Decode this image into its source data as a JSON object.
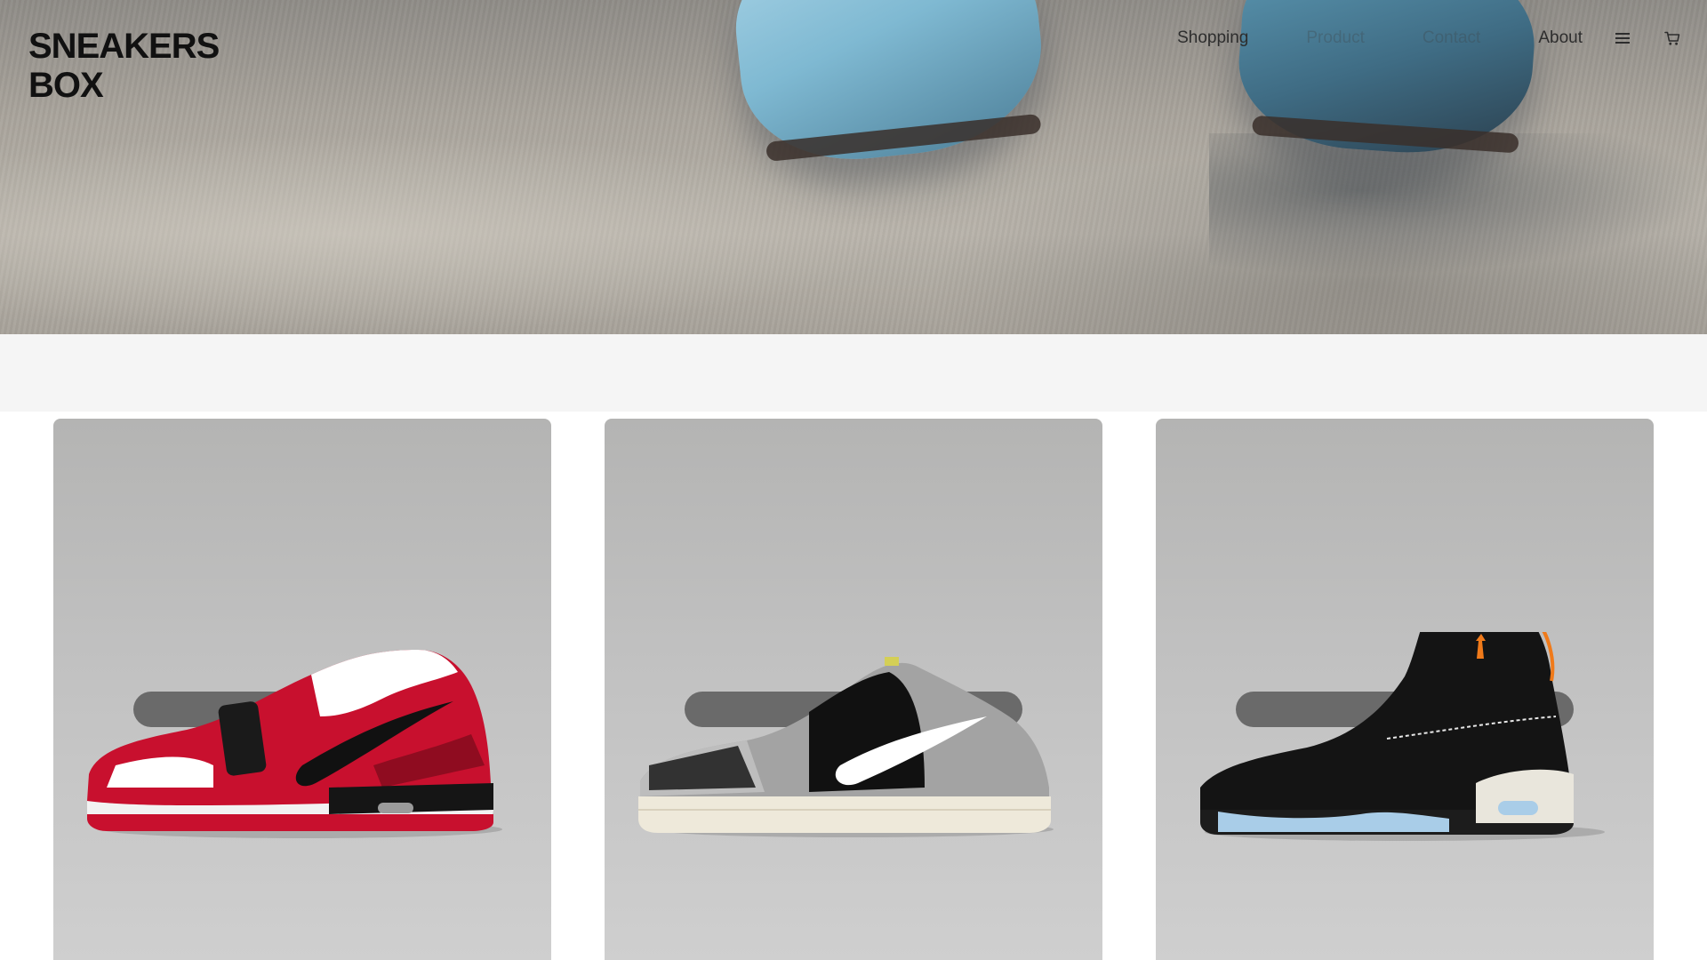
{
  "brand": {
    "line1": "SNEAKERS",
    "line2": "BOX"
  },
  "nav": {
    "items": [
      {
        "label": "Shopping"
      },
      {
        "label": "Product"
      },
      {
        "label": "Contact"
      },
      {
        "label": "About"
      }
    ],
    "menu_icon": "hamburger-menu-icon",
    "cart_icon": "shopping-cart-icon"
  },
  "hero": {
    "image": "close-up of light blue running sneakers on pavement"
  },
  "products": [
    {
      "image": "red white black low-top sneaker",
      "colors": [
        "#c8102e",
        "#ffffff",
        "#111111"
      ]
    },
    {
      "image": "black grey cement print low-top sneaker",
      "colors": [
        "#111111",
        "#9a9a9a",
        "#f1ecdf"
      ]
    },
    {
      "image": "black high-top sneaker with orange accents and icy sole",
      "colors": [
        "#111111",
        "#f07a1a",
        "#a9cde8"
      ]
    }
  ]
}
